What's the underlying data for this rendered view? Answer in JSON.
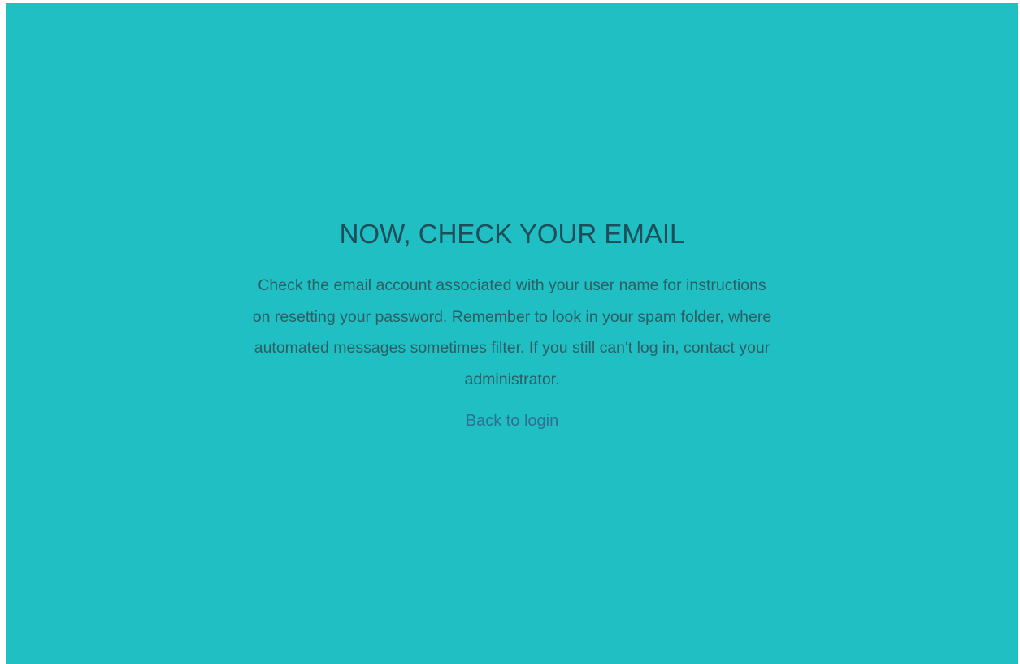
{
  "colors": {
    "background": "#1fbfc3",
    "title": "#1d4f5a",
    "text": "#2c5f63",
    "link": "#2e6f95"
  },
  "page": {
    "title": "NOW, CHECK YOUR EMAIL",
    "message": "Check the email account associated with your user name for instructions on resetting your password. Remember to look in your spam folder, where automated messages sometimes filter. If you still can't log in, contact your administrator.",
    "back_link_label": "Back to login"
  }
}
